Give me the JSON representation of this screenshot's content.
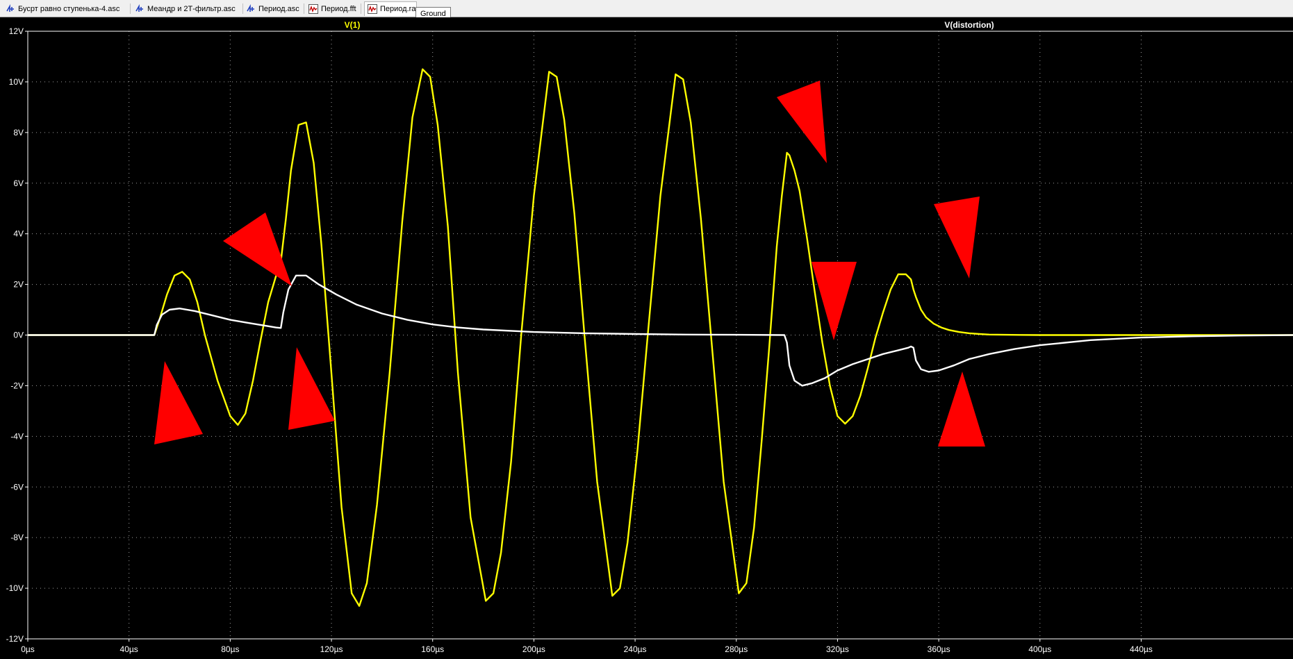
{
  "tabs": [
    {
      "label": "Бусрт равно ступенька-4.asc",
      "icon": "schematic-icon",
      "active": false
    },
    {
      "label": "Меандр и 2Т-фильтр.asc",
      "icon": "schematic-icon",
      "active": false
    },
    {
      "label": "Период.asc",
      "icon": "schematic-icon",
      "active": false
    },
    {
      "label": "Период.fft",
      "icon": "waveform-icon",
      "active": false
    },
    {
      "label": "Период.raw",
      "icon": "waveform-icon",
      "active": true
    }
  ],
  "tooltip": "Ground",
  "colors": {
    "background": "#000000",
    "axis": "#ffffff",
    "grid": "#a0a0a0",
    "trace1": "#ffff00",
    "trace2": "#ffffff",
    "markers": "#ff0000"
  },
  "chart_data": {
    "type": "line",
    "xlim": [
      0,
      500
    ],
    "ylim": [
      -12,
      12
    ],
    "x_ticks": [
      0,
      40,
      80,
      120,
      160,
      200,
      240,
      280,
      320,
      360,
      400,
      440
    ],
    "x_tick_labels": [
      "0µs",
      "40µs",
      "80µs",
      "120µs",
      "160µs",
      "200µs",
      "240µs",
      "280µs",
      "320µs",
      "360µs",
      "400µs",
      "440µs"
    ],
    "y_ticks": [
      12,
      10,
      8,
      6,
      4,
      2,
      0,
      -2,
      -4,
      -6,
      -8,
      -10,
      -12
    ],
    "y_tick_labels": [
      "12V",
      "10V",
      "8V",
      "6V",
      "4V",
      "2V",
      "0V",
      "-2V",
      "-4V",
      "-6V",
      "-8V",
      "-10V",
      "-12V"
    ],
    "grid": true,
    "series": [
      {
        "name": "V(1)",
        "color": "#ffff00",
        "x": [
          0,
          50,
          52,
          55,
          58,
          61,
          64,
          67,
          70,
          75,
          80,
          83,
          86,
          89,
          92,
          95,
          98,
          100,
          102,
          104,
          107,
          110,
          113,
          116,
          120,
          124,
          128,
          131,
          134,
          138,
          143,
          148,
          152,
          156,
          159,
          162,
          166,
          170,
          175,
          181,
          184,
          187,
          191,
          195,
          200,
          206,
          209,
          212,
          216,
          220,
          225,
          231,
          234,
          237,
          241,
          245,
          250,
          256,
          259,
          262,
          266,
          270,
          275,
          281,
          284,
          287,
          290,
          293,
          296,
          298,
          300,
          301,
          303,
          305,
          308,
          311,
          314,
          317,
          320,
          323,
          326,
          329,
          332,
          335,
          338,
          341,
          344,
          347,
          349,
          350,
          351,
          353,
          355,
          358,
          361,
          364,
          368,
          372,
          376,
          380,
          386,
          392,
          400,
          420,
          450,
          480,
          500
        ],
        "y": [
          0,
          0,
          0.6,
          1.6,
          2.35,
          2.5,
          2.2,
          1.3,
          0,
          -1.8,
          -3.2,
          -3.55,
          -3.1,
          -1.8,
          -0.2,
          1.3,
          2.3,
          2.9,
          4.6,
          6.5,
          8.3,
          8.4,
          6.8,
          3.6,
          -1.5,
          -6.8,
          -10.2,
          -10.7,
          -9.8,
          -6.7,
          -1.5,
          4.5,
          8.6,
          10.5,
          10.2,
          8.3,
          4.3,
          -1.5,
          -7.2,
          -10.5,
          -10.2,
          -8.6,
          -5.0,
          0,
          5.5,
          10.4,
          10.2,
          8.5,
          4.8,
          0,
          -5.8,
          -10.3,
          -10.0,
          -8.2,
          -4.5,
          0,
          5.5,
          10.3,
          10.1,
          8.4,
          4.6,
          0,
          -5.8,
          -10.2,
          -9.8,
          -7.6,
          -4.2,
          -0.5,
          3.5,
          5.5,
          7.2,
          7.1,
          6.5,
          5.7,
          3.8,
          1.7,
          -0.3,
          -2.0,
          -3.2,
          -3.5,
          -3.2,
          -2.4,
          -1.3,
          -0.1,
          0.9,
          1.8,
          2.4,
          2.4,
          2.2,
          1.8,
          1.5,
          1.0,
          0.7,
          0.45,
          0.3,
          0.2,
          0.12,
          0.07,
          0.04,
          0.02,
          0.01,
          0.005,
          0,
          0,
          0,
          0,
          0
        ]
      },
      {
        "name": "V(distortion)",
        "color": "#ffffff",
        "x": [
          0,
          50,
          51,
          53,
          56,
          60,
          66,
          72,
          80,
          86,
          92,
          98,
          100,
          101,
          103,
          106,
          110,
          115,
          122,
          130,
          140,
          150,
          160,
          170,
          180,
          200,
          220,
          240,
          260,
          280,
          299,
          300,
          301,
          303,
          306,
          310,
          315,
          320,
          326,
          332,
          338,
          344,
          348,
          349,
          350,
          351,
          353,
          356,
          360,
          366,
          372,
          380,
          390,
          400,
          420,
          440,
          460,
          480,
          500
        ],
        "y": [
          0,
          0,
          0.4,
          0.8,
          1.0,
          1.05,
          0.95,
          0.8,
          0.6,
          0.5,
          0.4,
          0.3,
          0.28,
          0.9,
          1.8,
          2.35,
          2.35,
          2.0,
          1.6,
          1.2,
          0.85,
          0.6,
          0.42,
          0.3,
          0.22,
          0.12,
          0.07,
          0.04,
          0.02,
          0.01,
          0,
          -0.3,
          -1.2,
          -1.8,
          -2.0,
          -1.9,
          -1.7,
          -1.4,
          -1.15,
          -0.95,
          -0.75,
          -0.6,
          -0.5,
          -0.45,
          -0.5,
          -1.0,
          -1.35,
          -1.45,
          -1.4,
          -1.2,
          -0.95,
          -0.75,
          -0.55,
          -0.4,
          -0.2,
          -0.1,
          -0.05,
          -0.02,
          0
        ]
      }
    ]
  }
}
